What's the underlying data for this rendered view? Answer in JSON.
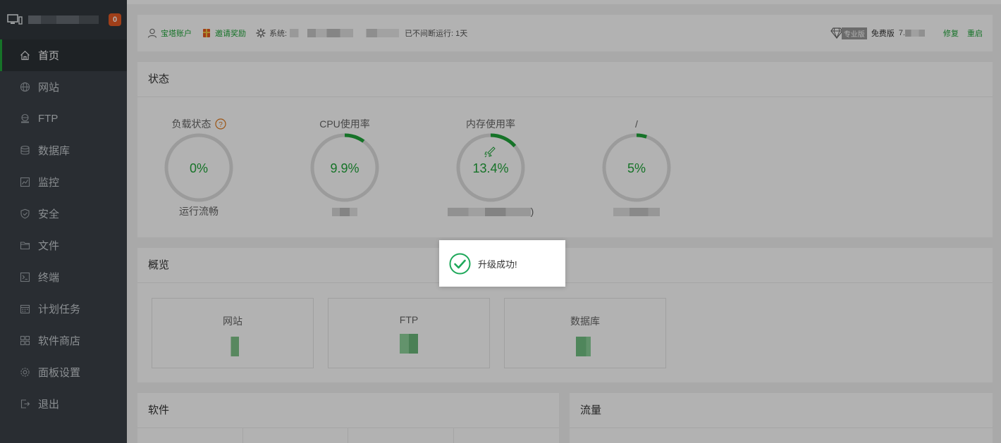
{
  "sidebar": {
    "badge": "0",
    "items": [
      {
        "label": "首页",
        "icon": "home-icon"
      },
      {
        "label": "网站",
        "icon": "globe-icon"
      },
      {
        "label": "FTP",
        "icon": "ftp-icon"
      },
      {
        "label": "数据库",
        "icon": "database-icon"
      },
      {
        "label": "监控",
        "icon": "monitor-chart-icon"
      },
      {
        "label": "安全",
        "icon": "shield-icon"
      },
      {
        "label": "文件",
        "icon": "folder-icon"
      },
      {
        "label": "终端",
        "icon": "terminal-icon"
      },
      {
        "label": "计划任务",
        "icon": "calendar-icon"
      },
      {
        "label": "软件商店",
        "icon": "grid-icon"
      },
      {
        "label": "面板设置",
        "icon": "gear-icon"
      },
      {
        "label": "退出",
        "icon": "logout-icon"
      }
    ]
  },
  "header": {
    "account": "宝塔账户",
    "invite": "邀请奖励",
    "system_label": "系统:",
    "uptime": "已不间断运行: 1天",
    "pro_label": "专业版",
    "free_label": "免费版",
    "version_prefix": "7.",
    "repair": "修复",
    "restart": "重启"
  },
  "status": {
    "title": "状态",
    "gauges": [
      {
        "label": "负载状态",
        "value": "0%",
        "sub": "运行流畅",
        "percent": 0,
        "has_help": true
      },
      {
        "label": "CPU使用率",
        "value": "9.9%",
        "sub": "",
        "percent": 9.9
      },
      {
        "label": "内存使用率",
        "value": "13.4%",
        "sub": ")",
        "percent": 13.4,
        "rocket": true
      },
      {
        "label": "/",
        "value": "5%",
        "sub": "",
        "percent": 5
      }
    ]
  },
  "overview": {
    "title": "概览",
    "items": [
      {
        "label": "网站"
      },
      {
        "label": "FTP"
      },
      {
        "label": "数据库"
      }
    ]
  },
  "software": {
    "title": "软件"
  },
  "traffic": {
    "title": "流量"
  },
  "toast": {
    "message": "升级成功!"
  },
  "colors": {
    "accent": "#20a53a",
    "sidebar": "#3b4148",
    "badge": "#e55b24"
  }
}
